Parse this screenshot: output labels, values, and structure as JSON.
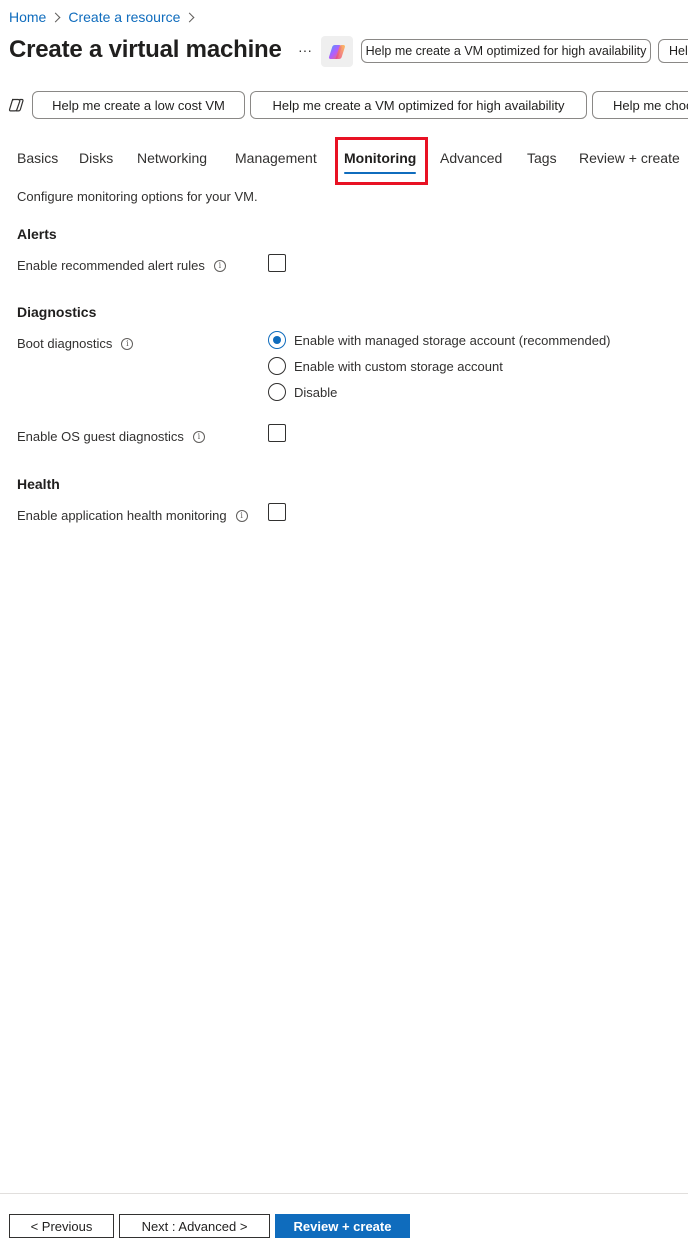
{
  "breadcrumb": {
    "items": [
      "Home",
      "Create a resource"
    ]
  },
  "header": {
    "title": "Create a virtual machine",
    "more": "···",
    "top_suggestions": [
      "Help me create a VM optimized for high availability",
      "Help"
    ]
  },
  "suggestions": [
    "Help me create a low cost VM",
    "Help me create a VM optimized for high availability",
    "Help me choo"
  ],
  "tabs": [
    {
      "label": "Basics",
      "active": false
    },
    {
      "label": "Disks",
      "active": false
    },
    {
      "label": "Networking",
      "active": false
    },
    {
      "label": "Management",
      "active": false
    },
    {
      "label": "Monitoring",
      "active": true
    },
    {
      "label": "Advanced",
      "active": false
    },
    {
      "label": "Tags",
      "active": false
    },
    {
      "label": "Review + create",
      "active": false
    }
  ],
  "description": "Configure monitoring options for your VM.",
  "alerts": {
    "heading": "Alerts",
    "recommended_rules_label": "Enable recommended alert rules",
    "recommended_rules_checked": false
  },
  "diagnostics": {
    "heading": "Diagnostics",
    "boot_label": "Boot diagnostics",
    "boot_options": [
      "Enable with managed storage account (recommended)",
      "Enable with custom storage account",
      "Disable"
    ],
    "boot_selected": "Enable with managed storage account (recommended)",
    "os_guest_label": "Enable OS guest diagnostics",
    "os_guest_checked": false
  },
  "health": {
    "heading": "Health",
    "app_monitoring_label": "Enable application health monitoring",
    "app_monitoring_checked": false
  },
  "footer": {
    "previous": "< Previous",
    "next": "Next : Advanced >",
    "review": "Review + create"
  },
  "colors": {
    "accent": "#0f6cbd",
    "highlight": "#e81123"
  },
  "icons": {
    "info": "info-icon",
    "copilot": "copilot-icon",
    "suggestion": "suggestion-icon"
  }
}
